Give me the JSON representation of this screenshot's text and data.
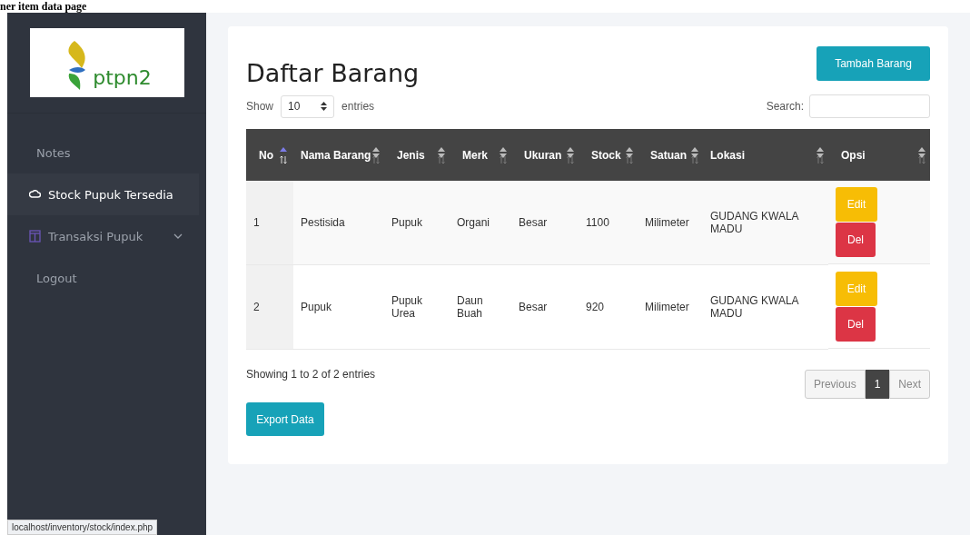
{
  "page_heading": "ner item data page",
  "sidebar": {
    "logo_text": "ptpn2",
    "items": [
      {
        "label": "Notes",
        "selected": false,
        "expandable": false
      },
      {
        "label": "Stock Pupuk Tersedia",
        "selected": true,
        "expandable": false
      },
      {
        "label": "Transaksi Pupuk",
        "selected": false,
        "expandable": true
      },
      {
        "label": "Logout",
        "selected": false,
        "expandable": false
      }
    ]
  },
  "title": "Daftar Barang",
  "add_button": "Tambah Barang",
  "length_menu": {
    "show": "Show",
    "value": "10",
    "entries": "entries"
  },
  "search": {
    "label": "Search:"
  },
  "table": {
    "columns": [
      {
        "label": "No",
        "sorted": true
      },
      {
        "label": "Nama Barang",
        "sorted": false
      },
      {
        "label": "Jenis",
        "sorted": false
      },
      {
        "label": "Merk",
        "sorted": false
      },
      {
        "label": "Ukuran",
        "sorted": false
      },
      {
        "label": "Stock",
        "sorted": false
      },
      {
        "label": "Satuan",
        "sorted": false
      },
      {
        "label": "Lokasi",
        "sorted": false
      },
      {
        "label": "Opsi",
        "sorted": false
      }
    ],
    "rows": [
      {
        "cells": [
          "1",
          "Pestisida",
          "Pupuk",
          "Organi",
          "Besar",
          "1100",
          "Milimeter",
          "GUDANG KWALA MADU"
        ],
        "edit": "Edit",
        "delete": "Del"
      },
      {
        "cells": [
          "2",
          "Pupuk",
          "Pupuk Urea",
          "Daun Buah",
          "Besar",
          "920",
          "Milimeter",
          "GUDANG KWALA MADU"
        ],
        "edit": "Edit",
        "delete": "Del"
      }
    ]
  },
  "info": "Showing 1 to 2 of 2 entries",
  "pagination": [
    {
      "label": "Previous",
      "kind": "prev",
      "selected": false
    },
    {
      "label": "1",
      "kind": "page",
      "selected": true
    },
    {
      "label": "Next",
      "kind": "next",
      "selected": false
    }
  ],
  "export_button": "Export Data",
  "status_url": "localhost/inventory/stock/index.php"
}
